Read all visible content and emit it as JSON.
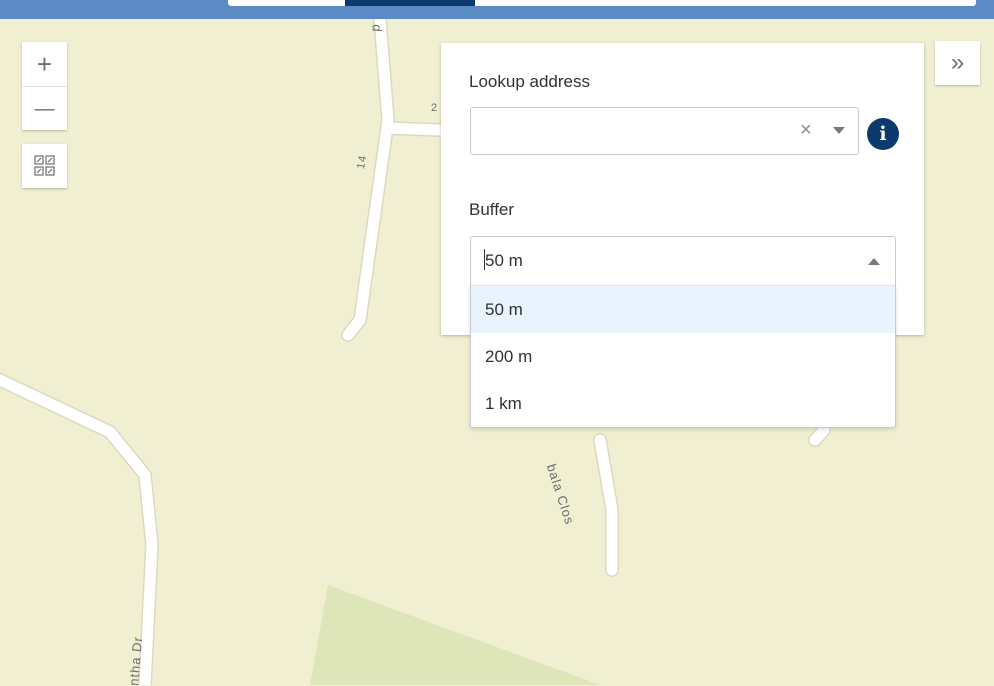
{
  "map": {
    "zoom_in_label": "+",
    "zoom_out_label": "—",
    "road_labels": {
      "upper_road_d": "d",
      "upper_road_num_14": "14",
      "upper_road_num_2": "2",
      "clos": "bala Clos",
      "dr": "ntha Dr"
    }
  },
  "icons": {
    "zoom_in": "plus-icon",
    "zoom_out": "minus-icon",
    "extent": "grid-extent-icon",
    "collapse": "double-chevron-right-icon",
    "info": "info-icon",
    "clear": "close-icon",
    "dropdown": "chevron-down-icon",
    "dropdown_open": "chevron-up-icon"
  },
  "panel": {
    "collapse_label": "»",
    "lookup": {
      "label": "Lookup address",
      "value": "",
      "placeholder": "",
      "clear_glyph": "×",
      "info_glyph": "i"
    },
    "buffer": {
      "label": "Buffer",
      "selected": "50 m",
      "options": [
        "50 m",
        "200 m",
        "1 km"
      ]
    }
  },
  "colors": {
    "map_background": "#f1efd2",
    "park": "#dde5b9",
    "road": "#ffffff",
    "accent": "#0c3a6e",
    "top_bar": "#5b8ac4",
    "selected_option": "#e8f3fd"
  }
}
